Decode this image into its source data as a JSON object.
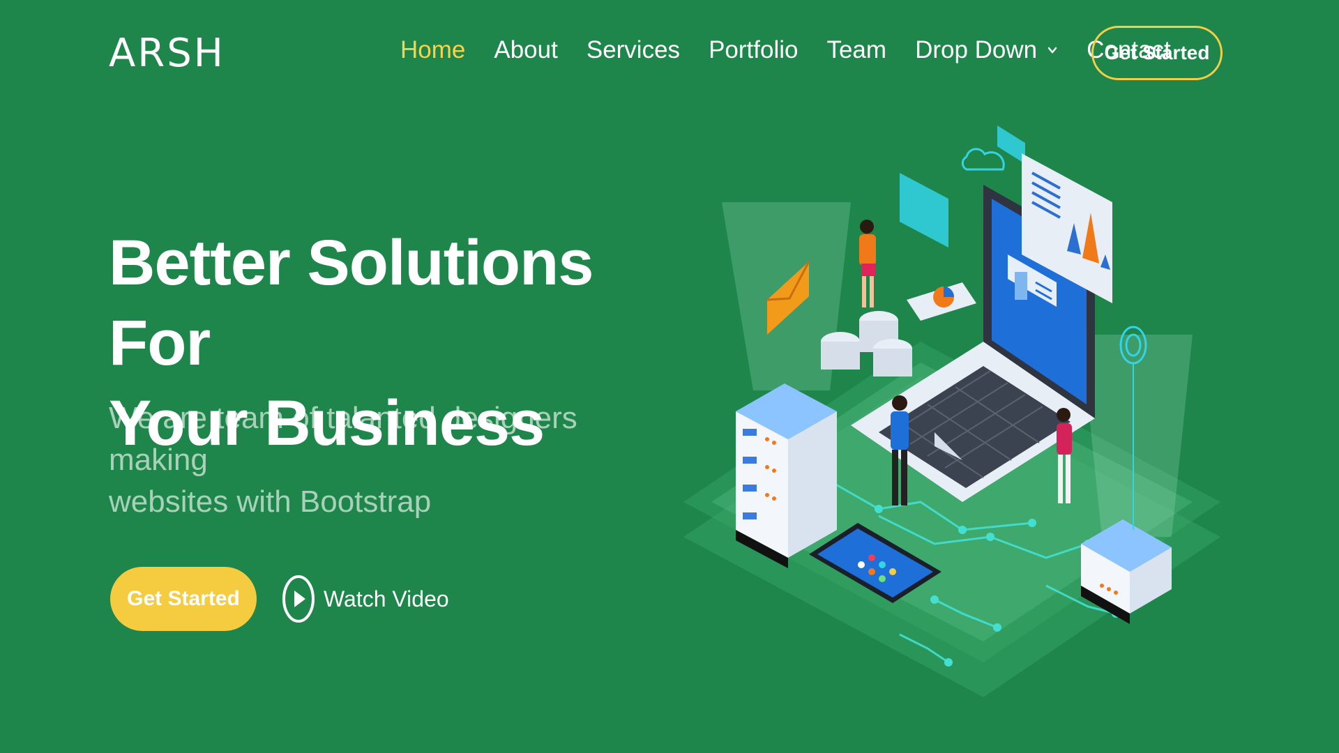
{
  "brand": {
    "logo": "ARSH"
  },
  "nav": {
    "items": [
      {
        "label": "Home",
        "active": true
      },
      {
        "label": "About",
        "active": false
      },
      {
        "label": "Services",
        "active": false
      },
      {
        "label": "Portfolio",
        "active": false
      },
      {
        "label": "Team",
        "active": false
      },
      {
        "label": "Drop Down",
        "active": false,
        "icon": "chevron-down-icon"
      },
      {
        "label": "Contact",
        "active": false
      }
    ],
    "cta": "Get Started"
  },
  "hero": {
    "title_line1": "Better Solutions For",
    "title_line2": "Your Business",
    "subtitle_line1": "We are team of talanted designers making",
    "subtitle_line2": "websites with Bootstrap",
    "primary_button": "Get Started",
    "video_link": "Watch Video",
    "video_icon": "play-circle-icon"
  },
  "colors": {
    "background": "#1e864b",
    "accent": "#f4cf46",
    "active_nav": "#f7d44c",
    "text": "#ffffff"
  }
}
